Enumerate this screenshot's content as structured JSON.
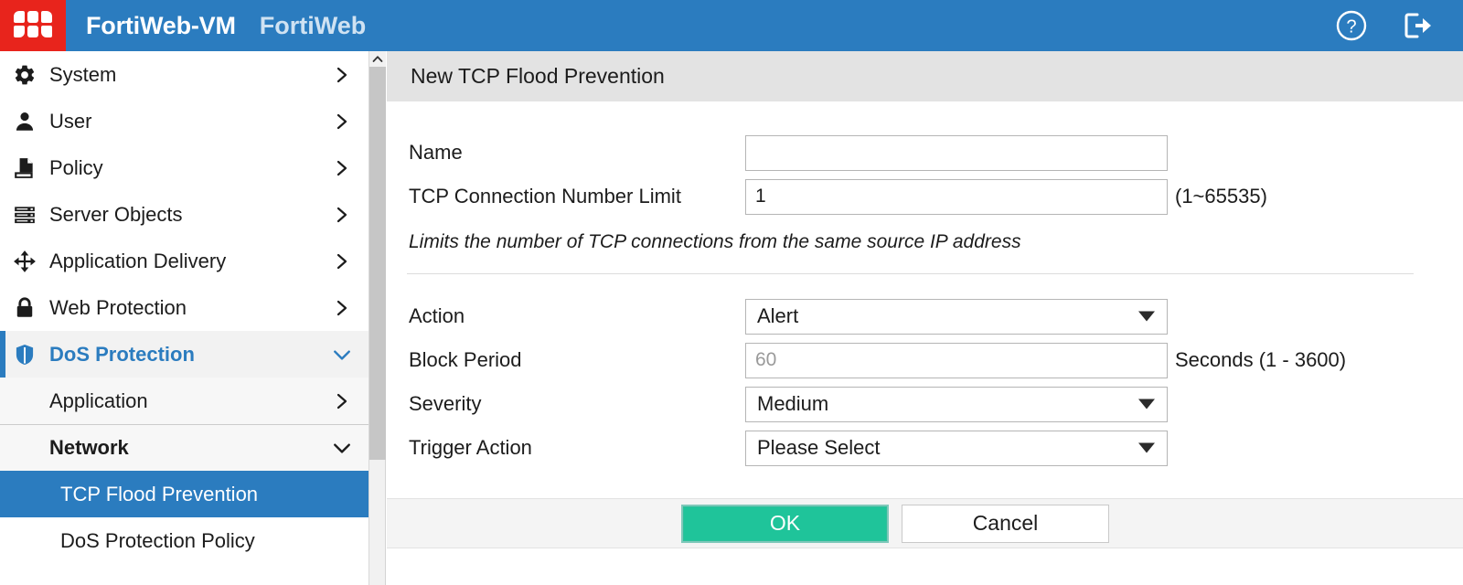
{
  "topbar": {
    "logo_icon": "fortinet-logo-icon",
    "product_name": "FortiWeb-VM",
    "product_family": "FortiWeb",
    "help_icon": "help-circle-icon",
    "logout_icon": "logout-icon"
  },
  "sidebar": {
    "items": [
      {
        "label": "System",
        "icon": "gear-icon",
        "chevron": "right"
      },
      {
        "label": "User",
        "icon": "user-icon",
        "chevron": "right"
      },
      {
        "label": "Policy",
        "icon": "policy-icon",
        "chevron": "right"
      },
      {
        "label": "Server Objects",
        "icon": "server-icon",
        "chevron": "right"
      },
      {
        "label": "Application Delivery",
        "icon": "move-arrows-icon",
        "chevron": "right"
      },
      {
        "label": "Web Protection",
        "icon": "lock-icon",
        "chevron": "right"
      },
      {
        "label": "DoS Protection",
        "icon": "shield-icon",
        "chevron": "down"
      }
    ],
    "subitems": [
      {
        "label": "Application",
        "chevron": "right"
      },
      {
        "label": "Network",
        "chevron": "down"
      }
    ],
    "leaf_items": [
      {
        "label": "TCP Flood Prevention",
        "selected": true
      },
      {
        "label": "DoS Protection Policy",
        "selected": false
      }
    ]
  },
  "main": {
    "panel_title": "New TCP Flood Prevention",
    "fields": {
      "name": {
        "label": "Name",
        "value": "",
        "placeholder": ""
      },
      "tcp_connection_number_limit": {
        "label": "TCP Connection Number Limit",
        "value": "1",
        "suffix": "(1~65535)"
      },
      "hint": "Limits the number of TCP connections from the same source IP address",
      "action": {
        "label": "Action",
        "value": "Alert"
      },
      "block_period": {
        "label": "Block Period",
        "value": "",
        "placeholder": "60",
        "suffix": "Seconds (1 - 3600)"
      },
      "severity": {
        "label": "Severity",
        "value": "Medium"
      },
      "trigger_action": {
        "label": "Trigger Action",
        "value": "Please Select"
      }
    },
    "buttons": {
      "ok": "OK",
      "cancel": "Cancel"
    }
  },
  "colors": {
    "brand_blue": "#2b7cbf",
    "brand_red": "#e8241c",
    "ok_green": "#1fc49a",
    "panel_header": "#e3e3e3"
  }
}
